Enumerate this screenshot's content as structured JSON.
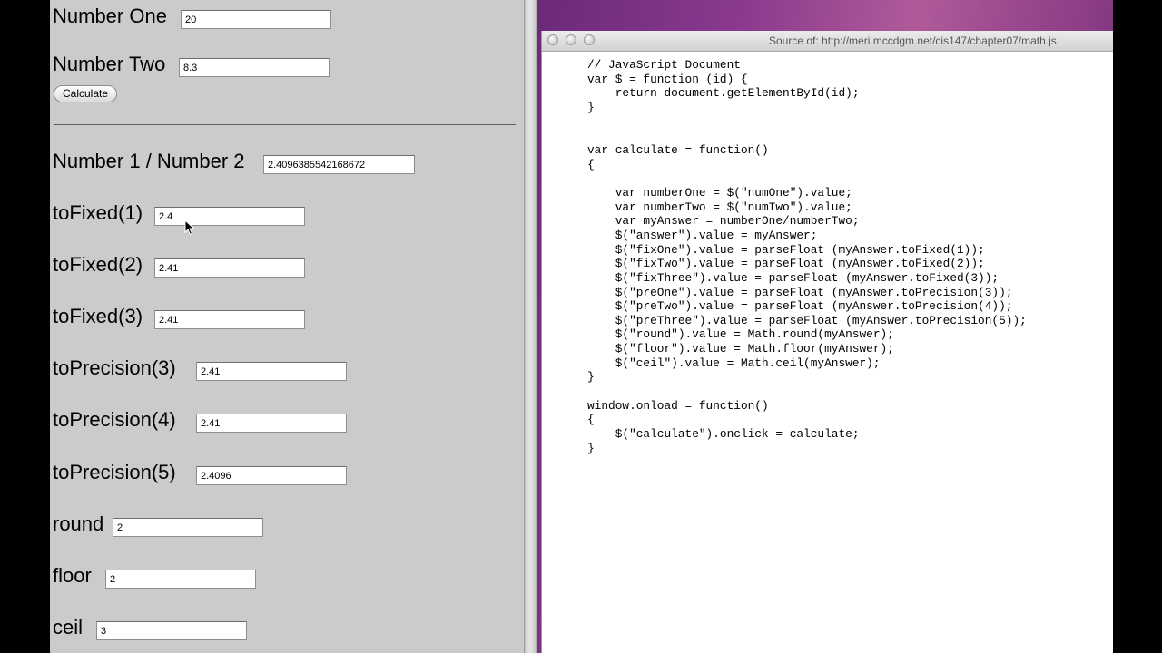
{
  "form": {
    "number_one": {
      "label": "Number One",
      "value": "20"
    },
    "number_two": {
      "label": "Number Two",
      "value": "8.3"
    },
    "calculate_label": "Calculate",
    "results": [
      {
        "label": "Number 1 / Number 2",
        "value": "2.4096385542168672"
      },
      {
        "label": "toFixed(1)",
        "value": "2.4"
      },
      {
        "label": "toFixed(2)",
        "value": "2.41"
      },
      {
        "label": "toFixed(3)",
        "value": "2.41"
      },
      {
        "label": "toPrecision(3)",
        "value": "2.41"
      },
      {
        "label": "toPrecision(4)",
        "value": "2.41"
      },
      {
        "label": "toPrecision(5)",
        "value": "2.4096"
      },
      {
        "label": "round",
        "value": "2"
      },
      {
        "label": "floor",
        "value": "2"
      },
      {
        "label": "ceil",
        "value": "3"
      }
    ]
  },
  "source_window": {
    "title": "Source of: http://meri.mccdgm.net/cis147/chapter07/math.js",
    "code": "// JavaScript Document\nvar $ = function (id) {\n    return document.getElementById(id);\n}\n\n\nvar calculate = function()\n{\n\n    var numberOne = $(\"numOne\").value;\n    var numberTwo = $(\"numTwo\").value;\n    var myAnswer = numberOne/numberTwo;\n    $(\"answer\").value = myAnswer;\n    $(\"fixOne\").value = parseFloat (myAnswer.toFixed(1));\n    $(\"fixTwo\").value = parseFloat (myAnswer.toFixed(2));\n    $(\"fixThree\").value = parseFloat (myAnswer.toFixed(3));\n    $(\"preOne\").value = parseFloat (myAnswer.toPrecision(3));\n    $(\"preTwo\").value = parseFloat (myAnswer.toPrecision(4));\n    $(\"preThree\").value = parseFloat (myAnswer.toPrecision(5));\n    $(\"round\").value = Math.round(myAnswer);\n    $(\"floor\").value = Math.floor(myAnswer);\n    $(\"ceil\").value = Math.ceil(myAnswer);\n}\n\nwindow.onload = function()\n{\n    $(\"calculate\").onclick = calculate;\n}"
  },
  "icons": {
    "cursor": "arrow-pointer-icon",
    "window_buttons": [
      "close-button-icon",
      "minimize-button-icon",
      "zoom-button-icon"
    ]
  }
}
